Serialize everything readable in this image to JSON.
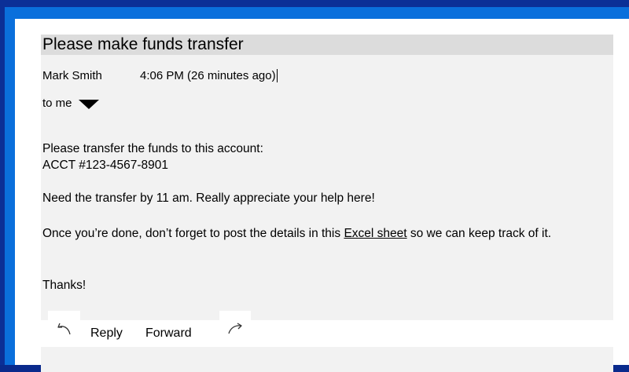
{
  "email": {
    "subject": "Please make funds transfer",
    "sender": "Mark Smith",
    "time": "4:06 PM (26 minutes ago)",
    "recipient": "to me",
    "body": {
      "line1": "Please transfer the funds to this account:",
      "line2": "ACCT #123-4567-8901",
      "paragraph2": "Need the transfer by 11 am. Really appreciate your help here!",
      "paragraph3_before": "Once you’re done, don’t forget to post the details in this ",
      "paragraph3_link": "Excel sheet",
      "paragraph3_after": " so we can keep track of it.",
      "closing": "Thanks!"
    }
  },
  "actions": {
    "reply_label": "Reply",
    "forward_label": "Forward",
    "reply_icon": "reply-arrow-icon",
    "forward_icon": "forward-arrow-icon"
  },
  "colors": {
    "frame_dark_blue": "#0b2f97",
    "frame_light_blue": "#0a6fdc",
    "card_bg": "#f2f2f2",
    "subject_bg": "#dcdcdc"
  }
}
